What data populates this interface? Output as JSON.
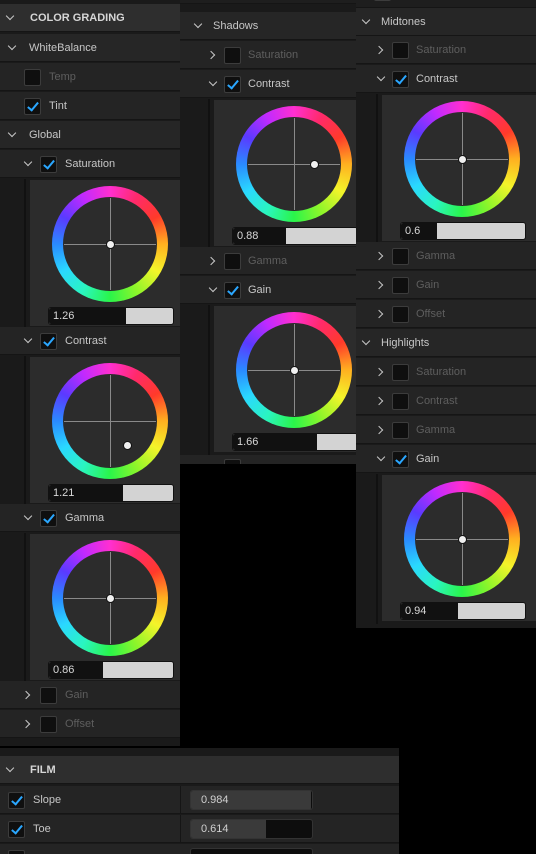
{
  "left": {
    "header": "COLOR GRADING",
    "white_balance": "WhiteBalance",
    "temp": "Temp",
    "tint": "Tint",
    "global": "Global",
    "saturation": {
      "label": "Saturation",
      "value": "1.26",
      "fill": 0.67
    },
    "contrast": {
      "label": "Contrast",
      "value": "1.21",
      "fill": 0.61
    },
    "gamma": {
      "label": "Gamma",
      "value": "0.86",
      "fill": 0.43
    },
    "gain": "Gain",
    "offset": "Offset"
  },
  "middle": {
    "shadows": "Shadows",
    "saturation": "Saturation",
    "contrast": {
      "label": "Contrast",
      "value": "0.88",
      "fill": 0.44
    },
    "gamma": "Gamma",
    "gain": {
      "label": "Gain",
      "value": "1.66",
      "fill": 0.83
    }
  },
  "right": {
    "midtones": "Midtones",
    "saturation": "Saturation",
    "contrast": {
      "label": "Contrast",
      "value": "0.6",
      "fill": 0.3
    },
    "gamma": "Gamma",
    "gain": "Gain",
    "offset": "Offset",
    "highlights": "Highlights",
    "h_saturation": "Saturation",
    "h_contrast": "Contrast",
    "h_gamma": "Gamma",
    "h_gain": {
      "label": "Gain",
      "value": "0.94",
      "fill": 0.47
    }
  },
  "film": {
    "header": "FILM",
    "slope": {
      "label": "Slope",
      "value": "0.984",
      "fill": 0.98
    },
    "toe": {
      "label": "Toe",
      "value": "0.614",
      "fill": 0.61
    }
  }
}
